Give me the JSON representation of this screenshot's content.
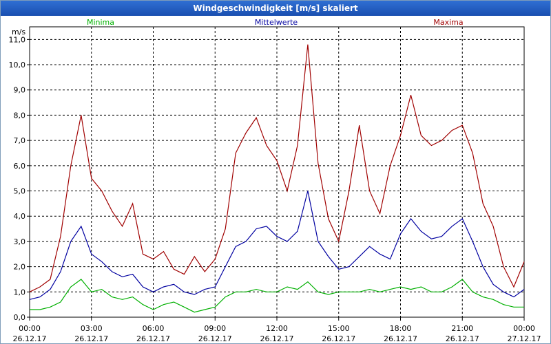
{
  "window": {
    "title": "Windgeschwindigkeit [m/s] skaliert"
  },
  "legend": [
    "Minima",
    "Mittelwerte",
    "Maxima"
  ],
  "colors": {
    "Minima": "#00b000",
    "Mittelwerte": "#0000a0",
    "Maxima": "#a00000"
  },
  "chart_data": {
    "type": "line",
    "title": "Windgeschwindigkeit [m/s] skaliert",
    "ylabel": "m/s",
    "xlabel": "",
    "ylim": [
      0,
      11.5
    ],
    "xlim": [
      0,
      24
    ],
    "grid": true,
    "yticks": [
      "0,0",
      "1,0",
      "2,0",
      "3,0",
      "4,0",
      "5,0",
      "6,0",
      "7,0",
      "8,0",
      "9,0",
      "10,0",
      "11,0"
    ],
    "xticks": [
      {
        "time": "00:00",
        "date": "26.12.17"
      },
      {
        "time": "03:00",
        "date": "26.12.17"
      },
      {
        "time": "06:00",
        "date": "26.12.17"
      },
      {
        "time": "09:00",
        "date": "26.12.17"
      },
      {
        "time": "12:00",
        "date": "26.12.17"
      },
      {
        "time": "15:00",
        "date": "26.12.17"
      },
      {
        "time": "18:00",
        "date": "26.12.17"
      },
      {
        "time": "21:00",
        "date": "26.12.17"
      },
      {
        "time": "00:00",
        "date": "27.12.17"
      }
    ],
    "series": [
      {
        "name": "Minima",
        "x": [
          0,
          0.5,
          1,
          1.5,
          2,
          2.5,
          3,
          3.5,
          4,
          4.5,
          5,
          5.5,
          6,
          6.5,
          7,
          7.5,
          8,
          8.5,
          9,
          9.5,
          10,
          10.5,
          11,
          11.5,
          12,
          12.5,
          13,
          13.5,
          14,
          14.5,
          15,
          15.5,
          16,
          16.5,
          17,
          17.5,
          18,
          18.5,
          19,
          19.5,
          20,
          20.5,
          21,
          21.5,
          22,
          22.5,
          23,
          23.5,
          24
        ],
        "values": [
          0.3,
          0.3,
          0.4,
          0.6,
          1.2,
          1.5,
          1.0,
          1.1,
          0.8,
          0.7,
          0.8,
          0.5,
          0.3,
          0.5,
          0.6,
          0.4,
          0.2,
          0.3,
          0.4,
          0.8,
          1.0,
          1.0,
          1.1,
          1.0,
          1.0,
          1.2,
          1.1,
          1.4,
          1.0,
          0.9,
          1.0,
          1.0,
          1.0,
          1.1,
          1.0,
          1.1,
          1.2,
          1.1,
          1.2,
          1.0,
          1.0,
          1.2,
          1.5,
          1.0,
          0.8,
          0.7,
          0.5,
          0.4,
          0.4
        ]
      },
      {
        "name": "Mittelwerte",
        "x": [
          0,
          0.5,
          1,
          1.5,
          2,
          2.5,
          3,
          3.5,
          4,
          4.5,
          5,
          5.5,
          6,
          6.5,
          7,
          7.5,
          8,
          8.5,
          9,
          9.5,
          10,
          10.5,
          11,
          11.5,
          12,
          12.5,
          13,
          13.5,
          14,
          14.5,
          15,
          15.5,
          16,
          16.5,
          17,
          17.5,
          18,
          18.5,
          19,
          19.5,
          20,
          20.5,
          21,
          21.5,
          22,
          22.5,
          23,
          23.5,
          24
        ],
        "values": [
          0.7,
          0.8,
          1.1,
          1.8,
          3.0,
          3.6,
          2.5,
          2.2,
          1.8,
          1.6,
          1.7,
          1.2,
          1.0,
          1.2,
          1.3,
          1.0,
          0.9,
          1.1,
          1.2,
          2.0,
          2.8,
          3.0,
          3.5,
          3.6,
          3.2,
          3.0,
          3.4,
          5.0,
          3.0,
          2.4,
          1.9,
          2.0,
          2.4,
          2.8,
          2.5,
          2.3,
          3.3,
          3.9,
          3.4,
          3.1,
          3.2,
          3.6,
          3.9,
          3.0,
          2.0,
          1.3,
          1.0,
          0.8,
          1.1
        ]
      },
      {
        "name": "Maxima",
        "x": [
          0,
          0.5,
          1,
          1.5,
          2,
          2.5,
          3,
          3.5,
          4,
          4.5,
          5,
          5.5,
          6,
          6.5,
          7,
          7.5,
          8,
          8.5,
          9,
          9.5,
          10,
          10.5,
          11,
          11.5,
          12,
          12.5,
          13,
          13.5,
          14,
          14.5,
          15,
          15.5,
          16,
          16.5,
          17,
          17.5,
          18,
          18.5,
          19,
          19.5,
          20,
          20.5,
          21,
          21.5,
          22,
          22.5,
          23,
          23.5,
          24
        ],
        "values": [
          1.0,
          1.2,
          1.5,
          3.2,
          6.0,
          8.0,
          5.5,
          5.0,
          4.2,
          3.6,
          4.5,
          2.5,
          2.3,
          2.6,
          1.9,
          1.7,
          2.4,
          1.8,
          2.3,
          3.5,
          6.5,
          7.3,
          7.9,
          6.8,
          6.2,
          5.0,
          6.8,
          10.8,
          6.1,
          3.9,
          3.0,
          5.0,
          7.6,
          5.0,
          4.1,
          6.0,
          7.2,
          8.8,
          7.2,
          6.8,
          7.0,
          7.4,
          7.6,
          6.5,
          4.5,
          3.6,
          2.0,
          1.2,
          2.2
        ]
      }
    ]
  }
}
